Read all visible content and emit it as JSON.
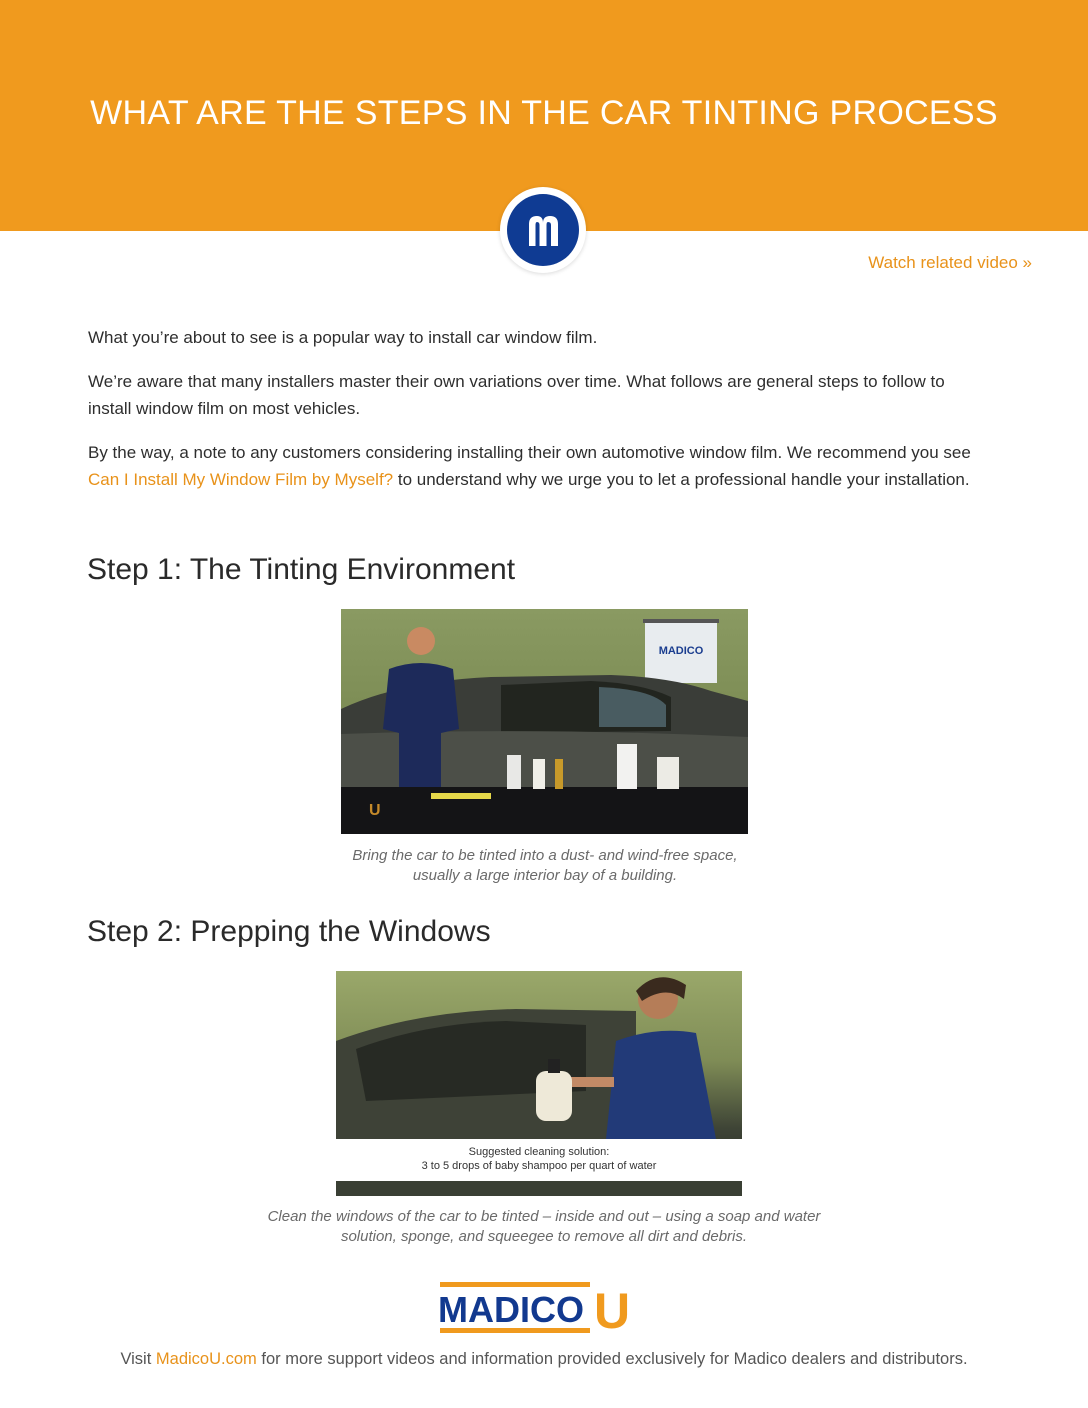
{
  "header": {
    "title": "WHAT ARE THE STEPS IN THE CAR TINTING PROCESS",
    "accent_color": "#f09a1e",
    "logo_icon": "madico-m-circle-icon"
  },
  "related_link": {
    "label": "Watch related video »"
  },
  "intro": {
    "p1": "What you’re about to see is a popular way to install car window film.",
    "p2": "We’re aware that many installers master their own variations over time. What follows are general steps to follow to install window film on most vehicles.",
    "p3_before": "By the way, a note to any customers considering installing their own automotive window film. We recommend you see ",
    "p3_link": "Can I Install My Window Film by Myself?",
    "p3_after": " to understand why we urge you to let a professional handle your installation."
  },
  "steps": [
    {
      "heading": "Step 1: The Tinting Environment",
      "photo_banner_text": "MADICO",
      "caption": "Bring the car to be tinted into a dust- and wind-free space, usually a large interior bay of a building."
    },
    {
      "heading": "Step 2: Prepping the Windows",
      "photo_overlay_line1": "Suggested cleaning solution:",
      "photo_overlay_line2": "3 to 5 drops of baby shampoo per quart of water",
      "caption": "Clean the windows of the car to be tinted – inside and out – using a soap and water solution, sponge, and squeegee to remove all dirt and debris."
    }
  ],
  "footer": {
    "logo_word": "MADICO",
    "logo_letter": "U",
    "logo_blue": "#12398f",
    "logo_orange": "#f09a1e",
    "text_before": "Visit ",
    "link": "MadicoU.com",
    "text_after": " for more support videos and information provided exclusively for Madico dealers and distributors."
  }
}
